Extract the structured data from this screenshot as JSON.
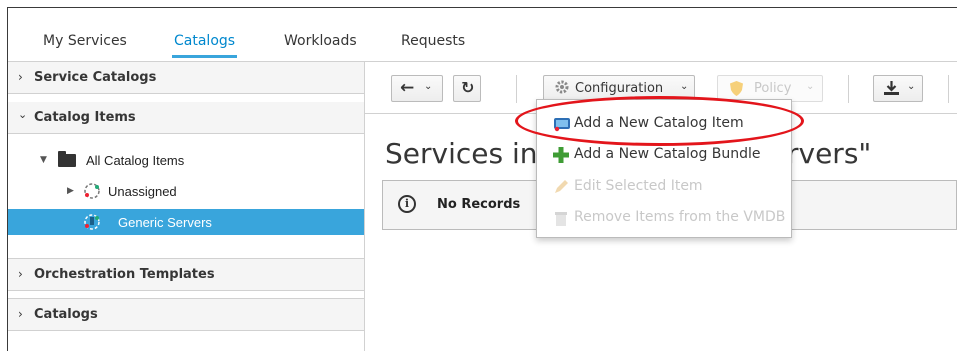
{
  "topnav": {
    "tabs": [
      {
        "label": "My Services"
      },
      {
        "label": "Catalogs"
      },
      {
        "label": "Workloads"
      },
      {
        "label": "Requests"
      }
    ],
    "active_tab": "Catalogs"
  },
  "sidebar": {
    "accordions": [
      {
        "label": "Service Catalogs",
        "state": "collapsed"
      },
      {
        "label": "Catalog Items",
        "state": "expanded"
      },
      {
        "label": "Orchestration Templates",
        "state": "collapsed"
      },
      {
        "label": "Catalogs",
        "state": "collapsed"
      }
    ],
    "tree": [
      {
        "label": "All Catalog Items",
        "icon": "folder-icon"
      },
      {
        "label": "Unassigned",
        "icon": "catalog-icon"
      },
      {
        "label": "Generic Servers",
        "icon": "catalog-icon",
        "selected": true
      }
    ]
  },
  "toolbar": {
    "configuration_label": "Configuration",
    "policy_label": "Policy"
  },
  "main": {
    "title_start": "Services in",
    "title_end": "rvers\"",
    "alert_message": "No Records"
  },
  "configuration_menu": {
    "items": [
      {
        "label": "Add a New Catalog Item",
        "icon": "add-catalog-item-icon",
        "enabled": true
      },
      {
        "label": "Add a New Catalog Bundle",
        "icon": "plus-icon",
        "enabled": true
      },
      {
        "label": "Edit Selected Item",
        "icon": "pencil-icon",
        "enabled": false
      },
      {
        "label": "Remove Items from the VMDB",
        "icon": "trash-icon",
        "enabled": false
      }
    ]
  },
  "colors": {
    "accent": "#0088ce",
    "selection": "#39a5dc",
    "highlight_ring": "#e3151b",
    "add_green": "#3f9c35"
  }
}
